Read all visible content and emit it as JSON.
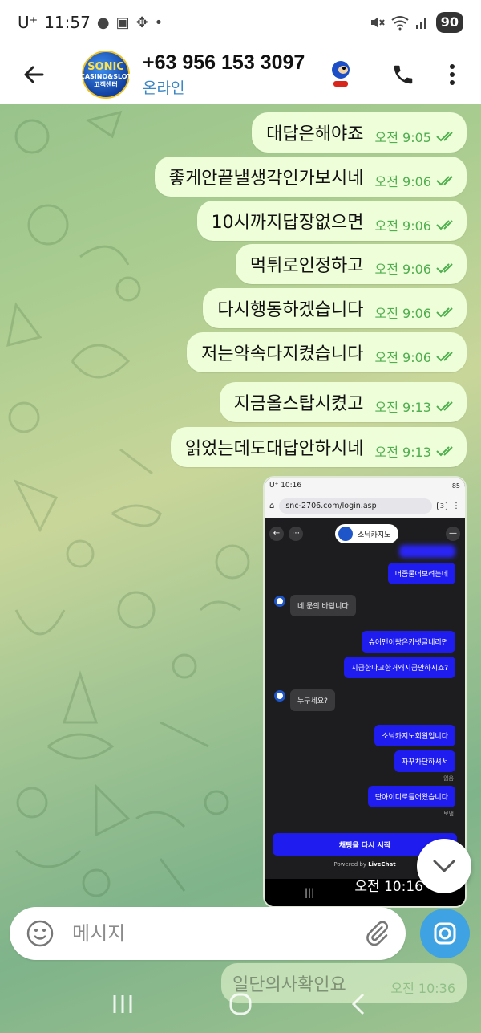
{
  "status_bar": {
    "carrier": "U⁺",
    "time": "11:57",
    "battery": "90"
  },
  "header": {
    "contact_name": "+63 956 153 3097",
    "status": "온라인",
    "avatar_text": "SONIC",
    "avatar_subtext": "CASINO&SLOT",
    "avatar_subtext2": "고객센터"
  },
  "messages": [
    {
      "text": "대답은해야죠",
      "time": "오전 9:05"
    },
    {
      "text": "좋게안끝낼생각인가보시네",
      "time": "오전 9:06"
    },
    {
      "text": "10시까지답장없으면",
      "time": "오전 9:06"
    },
    {
      "text": "먹튀로인정하고",
      "time": "오전 9:06"
    },
    {
      "text": "다시행동하겠습니다",
      "time": "오전 9:06"
    },
    {
      "text": "저는약속다지켰습니다",
      "time": "오전 9:06"
    },
    {
      "text": "지금올스탑시켰고",
      "time": "오전 9:13"
    },
    {
      "text": "읽었는데도대답안하시네",
      "time": "오전 9:13"
    }
  ],
  "screenshot": {
    "status_time": "U⁺ 10:16",
    "status_right": "85",
    "url": "snc-2706.com/login.asp",
    "tab_count": "3",
    "brand": "소닉카지노",
    "chat": [
      {
        "dir": "out",
        "text": "머좀물어보려는데"
      },
      {
        "dir": "in",
        "text": "네 문의 바랍니다"
      },
      {
        "dir": "out",
        "text": "슈어맨이랑온카넷글네리면"
      },
      {
        "dir": "out",
        "text": "지급한다고한거왜지급안하시죠?"
      },
      {
        "dir": "in",
        "text": "누구세요?"
      },
      {
        "dir": "out",
        "text": "소닉카지노회원입니다"
      },
      {
        "dir": "out",
        "text": "자꾸차단하셔서"
      },
      {
        "dir": "out",
        "text": "딴아이디로들어왔습니다"
      }
    ],
    "read_label": "읽음",
    "sent_label": "보냄",
    "restart_button": "채팅을 다시 시작",
    "powered_by": "Powered by",
    "powered_brand": "LiveChat",
    "time": "오전 10:16"
  },
  "input": {
    "placeholder": "메시지"
  },
  "faded_message": {
    "text": "일단의사확인요",
    "time": "오전 10:36"
  },
  "colors": {
    "bubble_out": "#eefed9",
    "time_green": "#4fae4e",
    "accent_blue": "#3fa3e3",
    "status_online": "#3b86c4"
  }
}
